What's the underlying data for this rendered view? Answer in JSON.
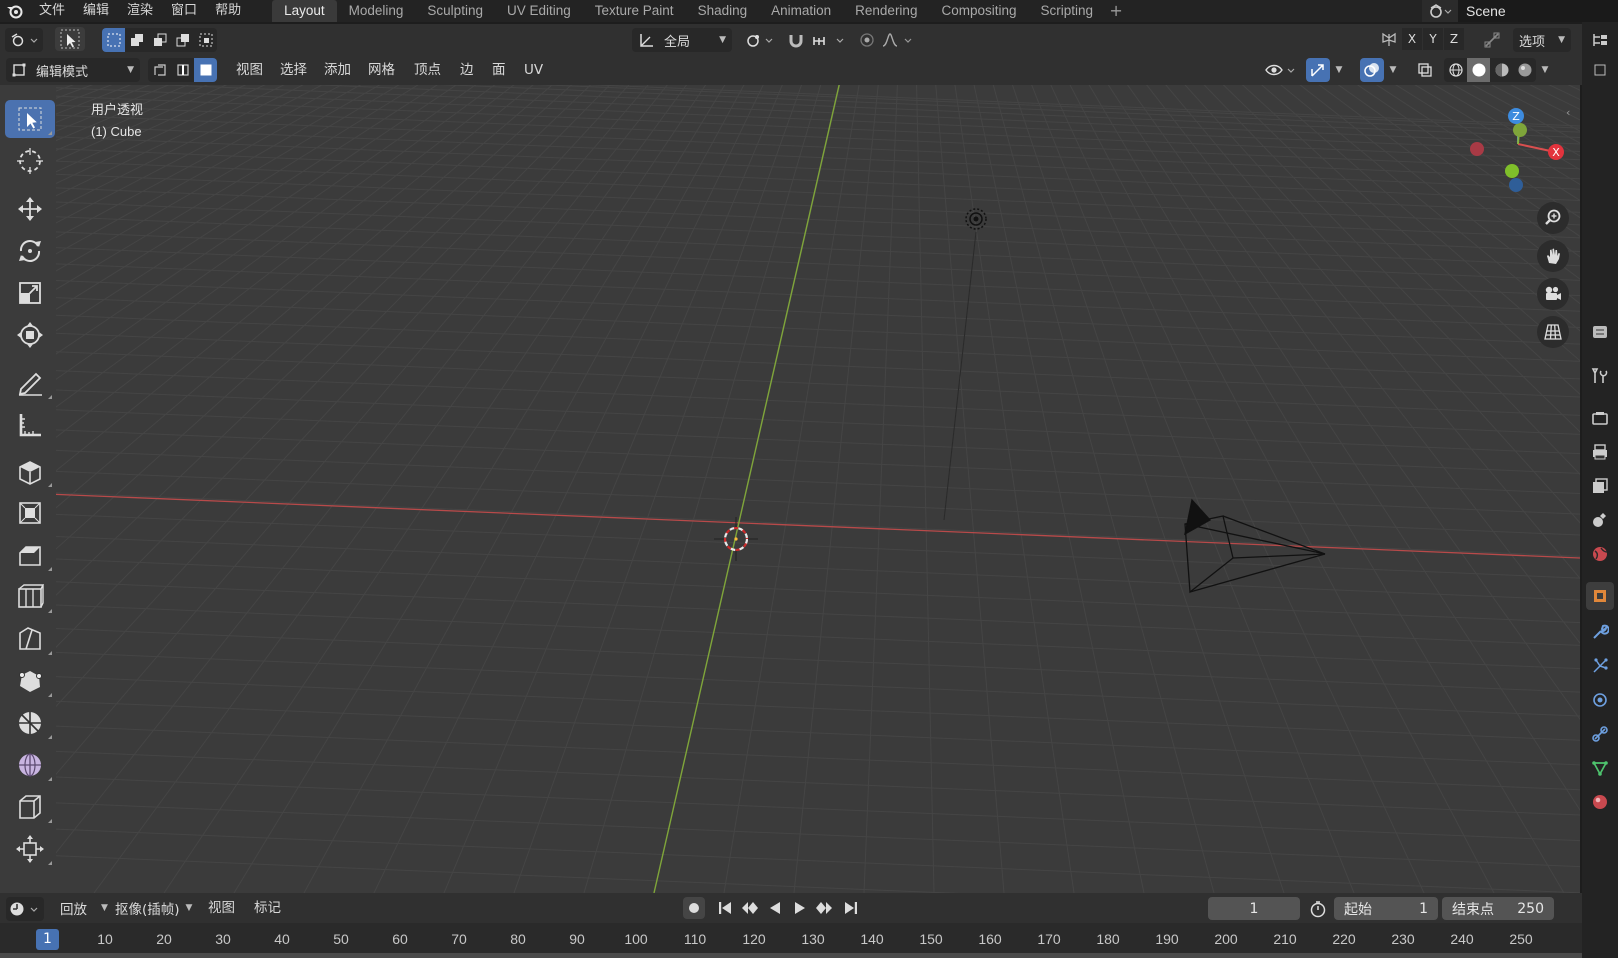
{
  "app": {
    "menus": [
      "文件",
      "编辑",
      "渲染",
      "窗口",
      "帮助"
    ],
    "workspaces": [
      "Layout",
      "Modeling",
      "Sculpting",
      "UV Editing",
      "Texture Paint",
      "Shading",
      "Animation",
      "Rendering",
      "Compositing",
      "Scripting"
    ],
    "active_workspace": "Layout",
    "add_workspace": "+",
    "scene_name": "Scene"
  },
  "header": {
    "transform_orientation": "全局",
    "options_label": "选项",
    "axes": [
      "X",
      "Y",
      "Z"
    ],
    "mode": "编辑模式",
    "menus": [
      "视图",
      "选择",
      "添加",
      "网格",
      "顶点",
      "边",
      "面",
      "UV"
    ]
  },
  "viewport": {
    "view_name": "用户透视",
    "object_name": "(1) Cube",
    "gizmo": {
      "z": "Z",
      "x": "X"
    }
  },
  "toolbar": {
    "tools": [
      "select-box",
      "cursor",
      "move",
      "rotate",
      "scale",
      "transform",
      "annotate",
      "measure",
      "extrude-region",
      "inset-faces",
      "bevel",
      "loop-cut",
      "knife",
      "poly-build",
      "spin",
      "smooth",
      "edge-slide",
      "shrink-fatten"
    ],
    "active_tool": "select-box"
  },
  "timeline": {
    "playback_label": "回放",
    "keying_label": "抠像(插帧)",
    "view_label": "视图",
    "marker_label": "标记",
    "current_frame": "1",
    "start_label": "起始",
    "start_value": "1",
    "end_label": "结束点",
    "end_value": "250",
    "ruler_ticks": [
      "1",
      "10",
      "20",
      "30",
      "40",
      "50",
      "60",
      "70",
      "80",
      "90",
      "100",
      "110",
      "120",
      "130",
      "140",
      "150",
      "160",
      "170",
      "180",
      "190",
      "200",
      "210",
      "220",
      "230",
      "240",
      "250"
    ]
  },
  "colors": {
    "active_blue": "#4772b3",
    "x_axis": "#d94f4f",
    "y_axis": "#8ab23b",
    "z_axis": "#3d8bde",
    "grid": "#454545",
    "viewport_bg": "#3b3b3b"
  }
}
